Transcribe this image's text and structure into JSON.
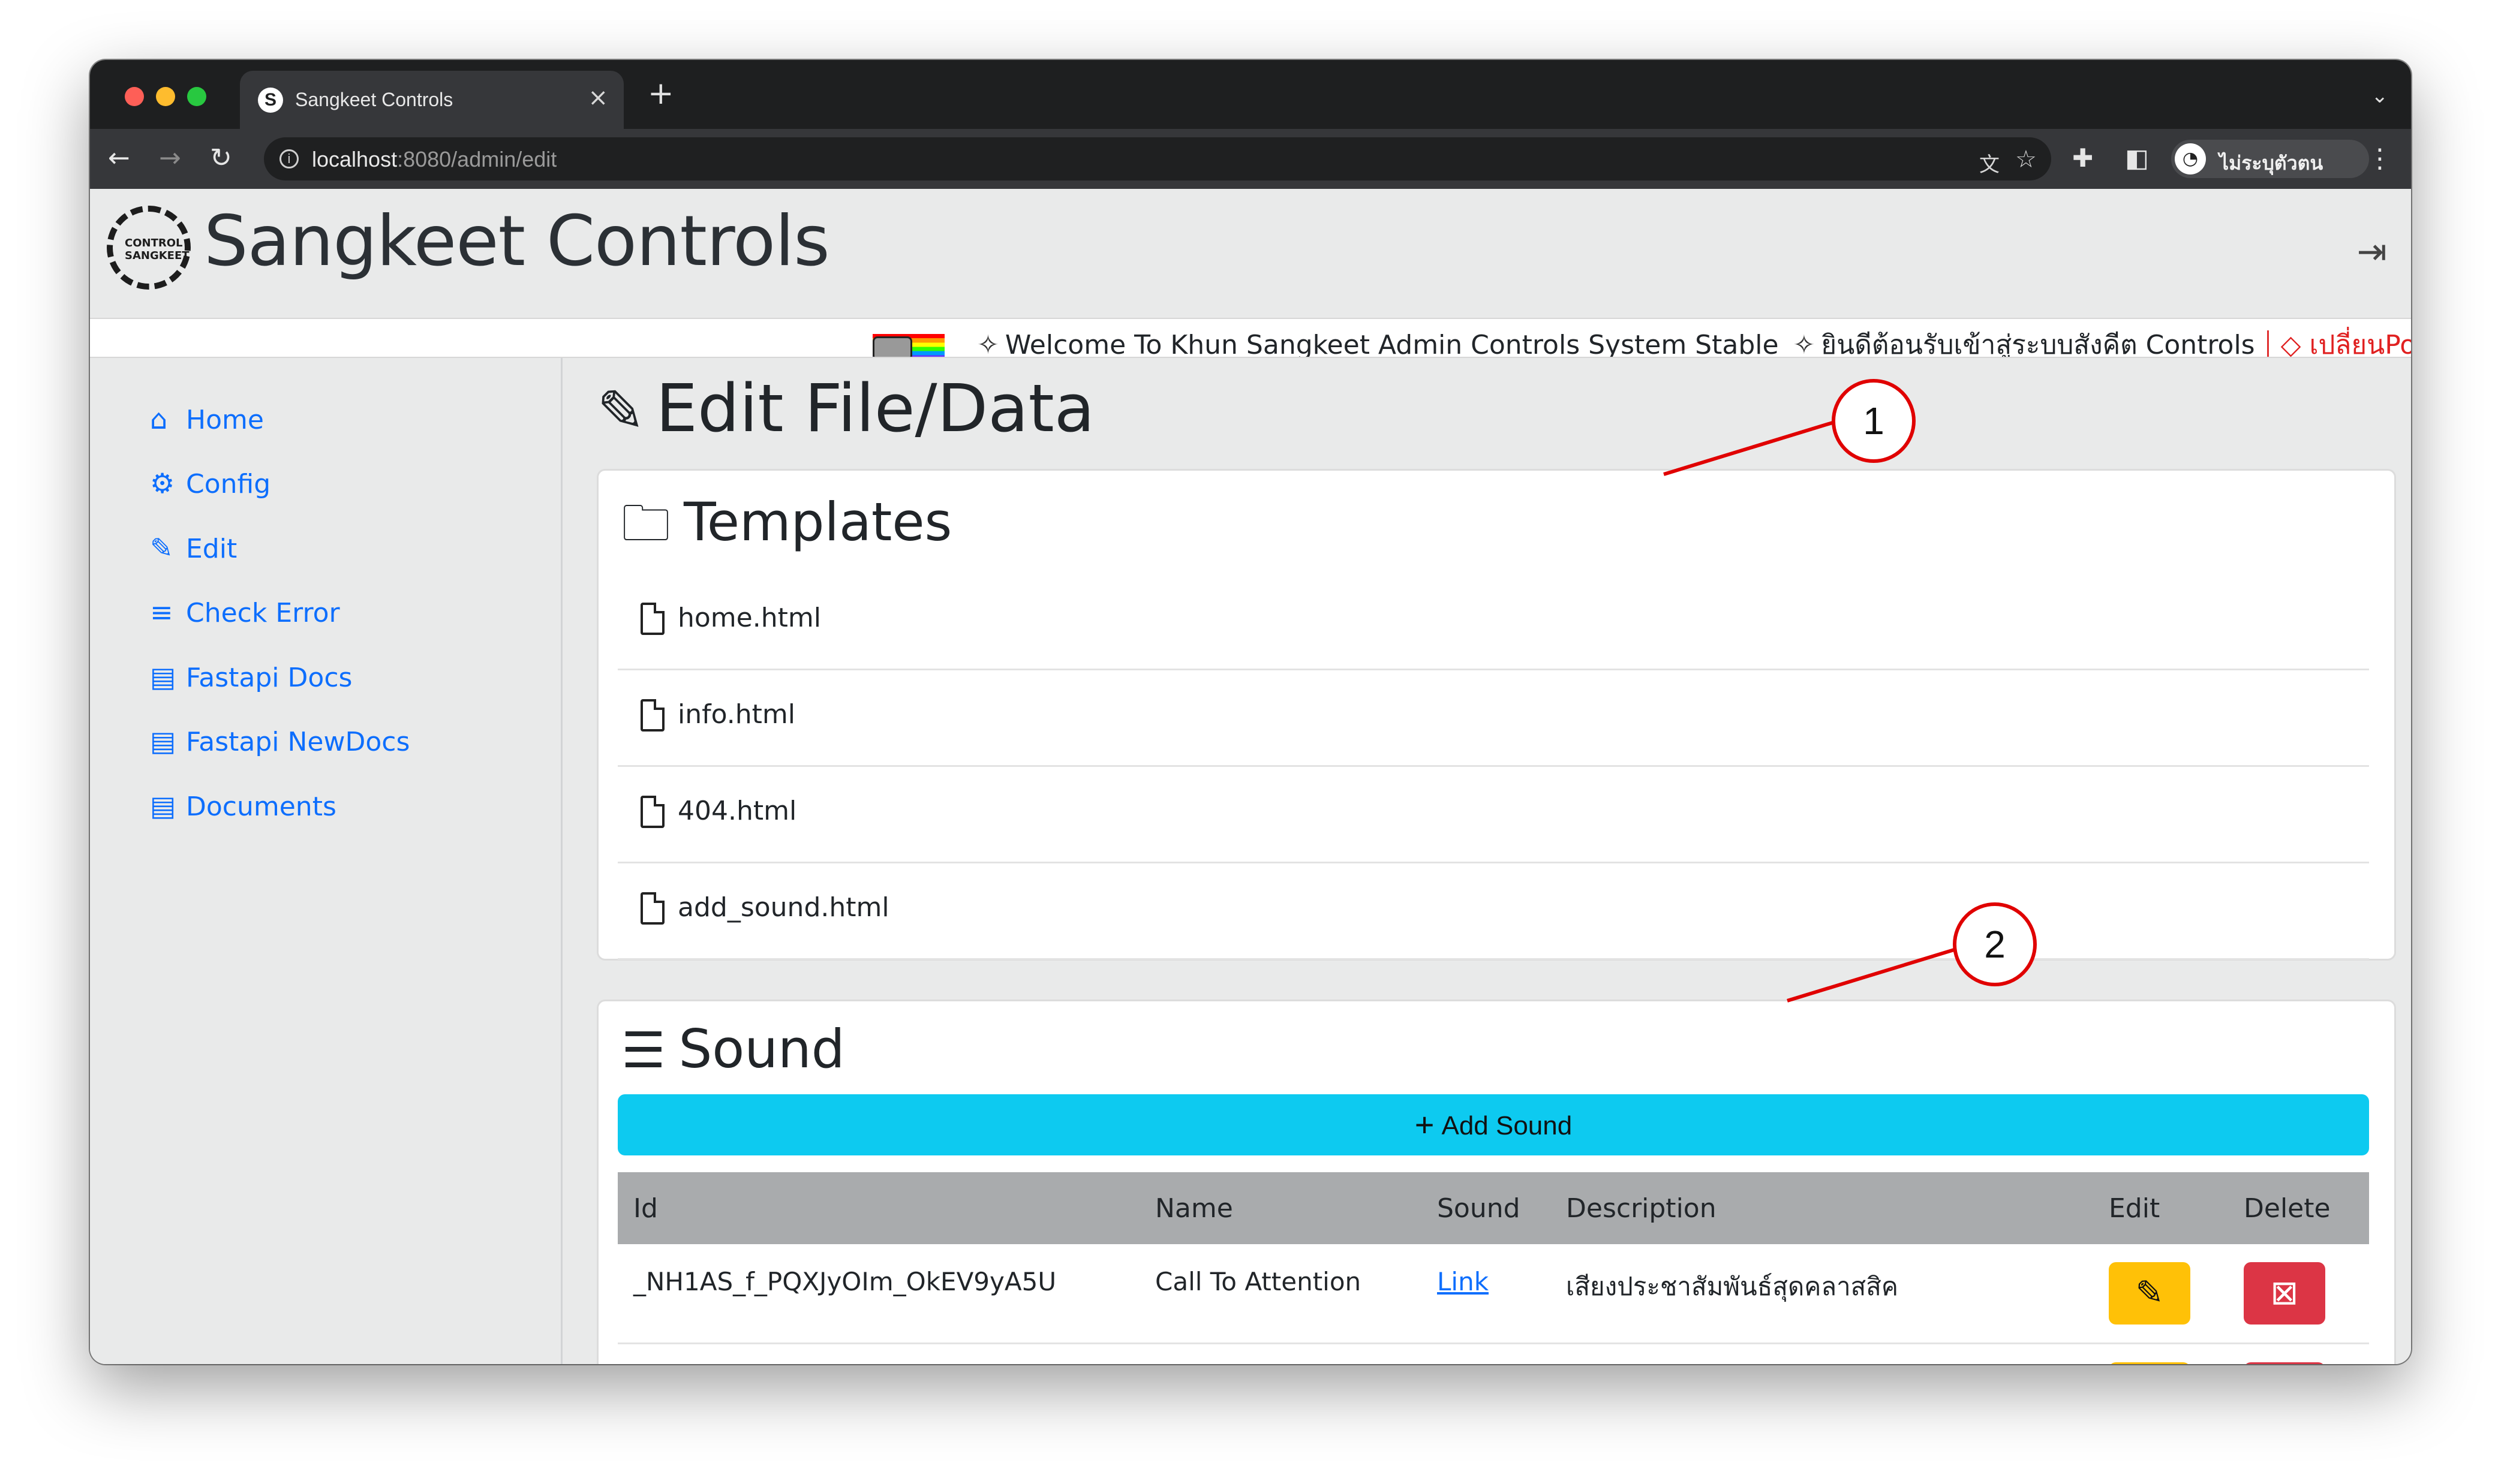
{
  "browser": {
    "tab_title": "Sangkeet Controls",
    "tab_close": "×",
    "new_tab": "+",
    "url_host": "localhost",
    "url_path": ":8080/admin/edit",
    "profile_name": "ไม่ระบุตัวตน",
    "icons": [
      "back-arrow-icon",
      "forward-arrow-icon",
      "reload-icon",
      "info-icon",
      "translate-icon",
      "star-icon",
      "puzzle-icon",
      "sidepanel-icon",
      "incognito-icon",
      "kebab-menu-icon",
      "chevron-down-icon"
    ]
  },
  "navbar": {
    "brand": "Sangkeet Controls",
    "logo_text": "CONTROL SANGKEET"
  },
  "marquee": {
    "welcome_en": "Welcome To Khun Sangkeet Admin Controls System Stable",
    "welcome_th": "ยินดีต้อนรับเข้าสู่ระบบสังคีต Controls",
    "warning": "เปลี่ยนPortต้อ"
  },
  "sidebar": {
    "items": [
      {
        "label": "Home",
        "icon": "house-icon"
      },
      {
        "label": "Config",
        "icon": "gear-icon"
      },
      {
        "label": "Edit",
        "icon": "pencil-icon"
      },
      {
        "label": "Check Error",
        "icon": "list-check-icon"
      },
      {
        "label": "Fastapi Docs",
        "icon": "document-icon"
      },
      {
        "label": "Fastapi NewDocs",
        "icon": "document-icon"
      },
      {
        "label": "Documents",
        "icon": "document-icon"
      }
    ]
  },
  "main": {
    "title": "Edit File/Data",
    "templates": {
      "title": "Templates",
      "files": [
        "home.html",
        "info.html",
        "404.html",
        "add_sound.html"
      ]
    },
    "sound": {
      "title": "Sound",
      "add_button": "Add Sound",
      "columns": [
        "Id",
        "Name",
        "Sound",
        "Description",
        "Edit",
        "Delete"
      ],
      "rows": [
        {
          "id": "_NH1AS_f_PQXJyOIm_OkEV9yA5U",
          "name": "Call To Attention",
          "sound": "Link",
          "description": "เสียงประชาสัมพันธ์สุดคลาสสิค"
        }
      ]
    }
  },
  "annotations": {
    "callout_1": "1",
    "callout_2": "2",
    "color": "#e00000"
  },
  "colors": {
    "primary": "#0d6efd",
    "info": "#0dcaf0",
    "warning": "#ffc107",
    "danger": "#dc3545"
  }
}
